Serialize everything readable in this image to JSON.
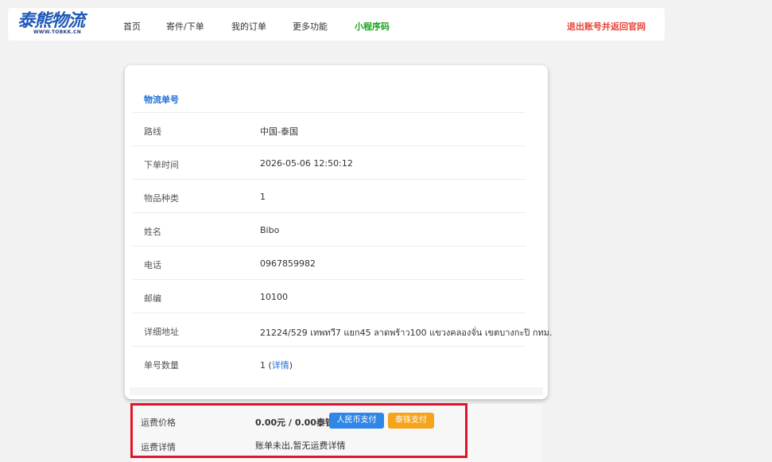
{
  "nav": {
    "logo_main": "泰熊物流",
    "logo_sub": "WWW.TOBKK.CN",
    "items": [
      {
        "label": "首页"
      },
      {
        "label": "寄件/下单"
      },
      {
        "label": "我的订单"
      },
      {
        "label": "更多功能"
      },
      {
        "label": "小程序码"
      }
    ],
    "logout": "退出账号并返回官网"
  },
  "order": {
    "title": "物流单号",
    "rows": [
      {
        "label": "路线",
        "value": "中国-泰国"
      },
      {
        "label": "下单时间",
        "value": "2026-05-06 12:50:12"
      },
      {
        "label": "物品种类",
        "value": "1"
      },
      {
        "label": "姓名",
        "value": "Bibo"
      },
      {
        "label": "电话",
        "value": "0967859982"
      },
      {
        "label": "邮编",
        "value": "10100"
      },
      {
        "label": "详细地址",
        "value": "21224/529 เทพทวี7 แยก45 ลาดพร้าว100 แขวงคลองจั่น เขตบางกะปิ กทม."
      },
      {
        "label": "单号数量",
        "value": "1 (",
        "link": "详情",
        "suffix": ")"
      }
    ]
  },
  "fee": {
    "price_label": "运费价格",
    "price_value": "0.00元 / 0.00泰铢",
    "pay_rmb": "人民币支付",
    "pay_thb": "泰铢支付",
    "detail_label": "运费详情",
    "detail_value": "账单未出,暂无运费详情"
  },
  "colors": {
    "brand_blue": "#1f58b8",
    "link_blue": "#1f6fd6",
    "green": "#1aa51a",
    "red": "#e8443a",
    "highlight_red": "#e0142a",
    "btn_blue": "#2f86e6",
    "btn_orange": "#f5a41b"
  }
}
